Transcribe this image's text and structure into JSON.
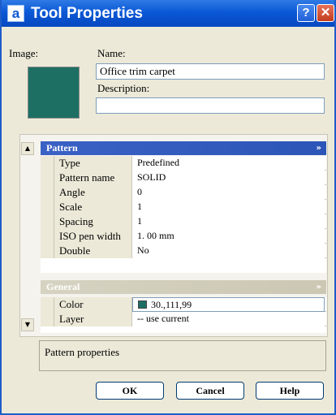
{
  "window": {
    "title": "Tool Properties",
    "app_icon_letter": "a",
    "help_glyph": "?",
    "close_glyph": "✕"
  },
  "tool": {
    "image_label": "Image:",
    "image_color": "#1e6f63",
    "name_label": "Name:",
    "name_value": "Office trim carpet",
    "description_label": "Description:",
    "description_value": ""
  },
  "palette": {
    "scroll_up_glyph": "▲",
    "scroll_down_glyph": "▼",
    "sections": {
      "pattern": {
        "title": "Pattern",
        "toggle_glyph": "»",
        "rows": [
          {
            "name": "Type",
            "value": "Predefined"
          },
          {
            "name": "Pattern name",
            "value": "SOLID"
          },
          {
            "name": "Angle",
            "value": "0"
          },
          {
            "name": "Scale",
            "value": "1"
          },
          {
            "name": "Spacing",
            "value": "1"
          },
          {
            "name": "ISO pen width",
            "value": "1. 00 mm"
          },
          {
            "name": "Double",
            "value": "No"
          }
        ]
      },
      "general": {
        "title": "General",
        "toggle_glyph": "»",
        "rows": [
          {
            "name": "Color",
            "value": "30.,111,99",
            "chip_color": "#1e6f63"
          },
          {
            "name": "Layer",
            "value": "-- use current"
          }
        ]
      }
    }
  },
  "description_panel": {
    "text": "Pattern properties"
  },
  "buttons": {
    "ok": "OK",
    "cancel": "Cancel",
    "help": "Help"
  },
  "colors": {
    "titlebar": "#0a58d6",
    "pattern_header": "#3a62c4",
    "general_header": "#d7d3c2",
    "dialog_bg": "#ece9d8"
  }
}
